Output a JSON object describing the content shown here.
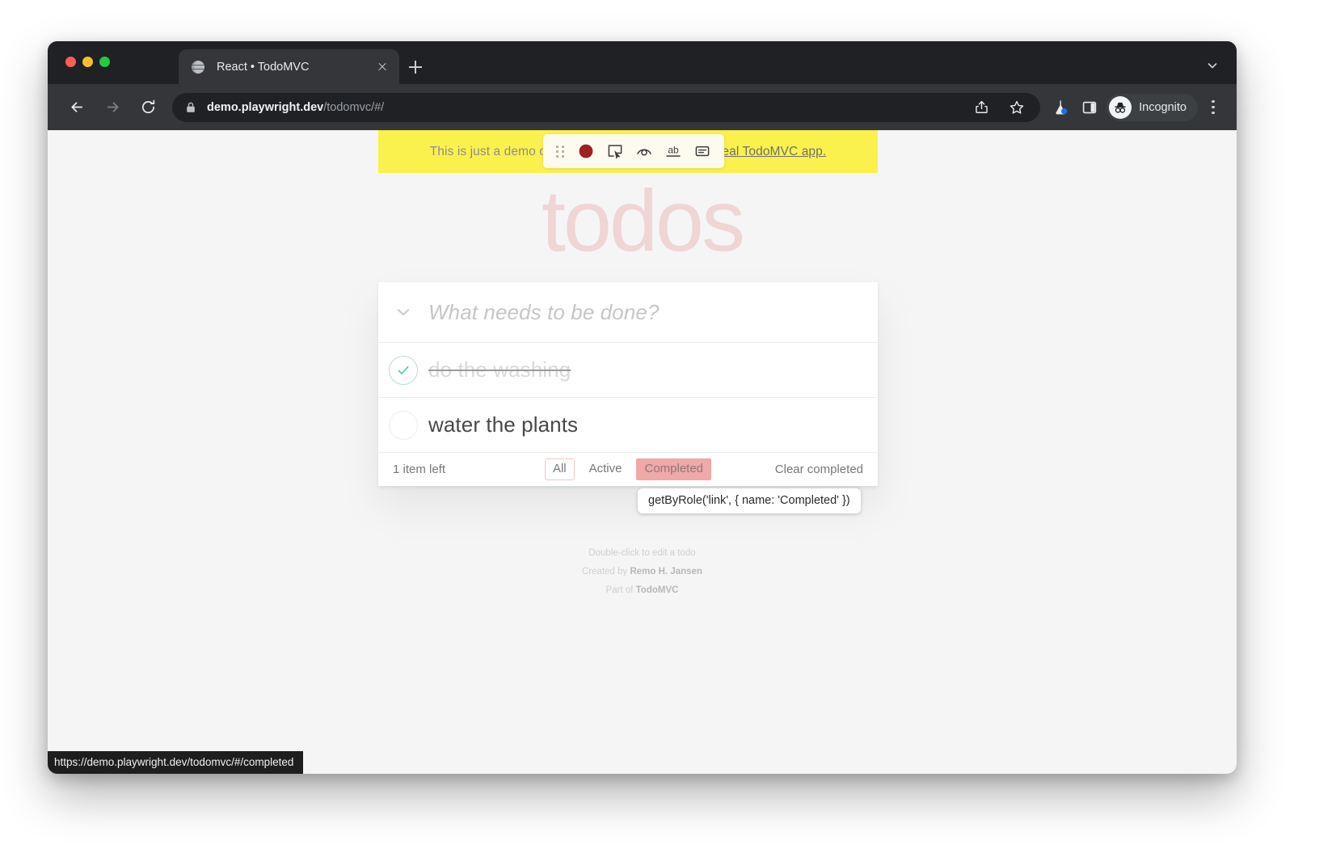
{
  "window": {
    "traffic_lights": [
      "close",
      "minimize",
      "maximize"
    ]
  },
  "tabstrip": {
    "tab_title": "React • TodoMVC",
    "favicon": "react-globe-icon",
    "close_icon": "close-icon",
    "new_tab_icon": "plus-icon",
    "list_chevron_icon": "chevron-down-icon"
  },
  "toolbar": {
    "back_icon": "back-arrow-icon",
    "forward_icon": "forward-arrow-icon",
    "reload_icon": "reload-icon",
    "lock_icon": "lock-icon",
    "url_bold": "demo.playwright.dev",
    "url_dim": "/todomvc/#/",
    "url_full": "demo.playwright.dev/todomvc/#/",
    "share_icon": "share-icon",
    "bookmark_icon": "star-icon",
    "extension_icon": "playwright-flask-icon",
    "sidepanel_icon": "side-panel-icon",
    "profile_label": "Incognito",
    "profile_avatar_icon": "incognito-hat-icon",
    "menu_icon": "kebab-menu-icon"
  },
  "banner": {
    "text_before": "This is just a demo of TodoMVC for testing, not the ",
    "link_text": "real TodoMVC app."
  },
  "recorder_toolbar": {
    "drag_handle_icon": "drag-handle-dots-icon",
    "buttons": [
      {
        "name": "record-button",
        "icon": "record-circle-icon"
      },
      {
        "name": "pick-locator-button",
        "icon": "cursor-in-box-icon"
      },
      {
        "name": "assert-visibility-button",
        "icon": "eye-icon"
      },
      {
        "name": "assert-text-button",
        "icon": "ab-text-icon"
      },
      {
        "name": "assert-value-button",
        "icon": "value-box-icon"
      }
    ]
  },
  "todoapp": {
    "title": "todos",
    "toggle_all_icon": "chevron-down-icon",
    "new_todo_placeholder": "What needs to be done?",
    "new_todo_value": "",
    "items": [
      {
        "label": "do the washing",
        "completed": true,
        "toggle_icon": "check-circle-icon"
      },
      {
        "label": "water the plants",
        "completed": false,
        "toggle_icon": "empty-circle-icon"
      }
    ],
    "footer": {
      "count_text": "1 item left",
      "filters": [
        {
          "label": "All",
          "state": "selected"
        },
        {
          "label": "Active",
          "state": "normal"
        },
        {
          "label": "Completed",
          "state": "highlighted"
        }
      ],
      "clear_completed_label": "Clear completed"
    }
  },
  "app_info": {
    "line1": "Double-click to edit a todo",
    "line2_prefix": "Created by ",
    "line2_author": "Remo H. Jansen",
    "line3_prefix": "Part of ",
    "line3_project": "TodoMVC"
  },
  "locator_tooltip": {
    "text": "getByRole('link', { name: 'Completed' })"
  },
  "status_bubble": {
    "url": "https://demo.playwright.dev/todomvc/#/completed"
  },
  "colors": {
    "banner_yellow": "#fbf14e",
    "todo_title_pink": "#f0d5d5",
    "highlight_pink": "#f0a8a8",
    "check_green": "#5dc2af",
    "chrome_dark": "#35363a",
    "chrome_darker": "#202124"
  }
}
